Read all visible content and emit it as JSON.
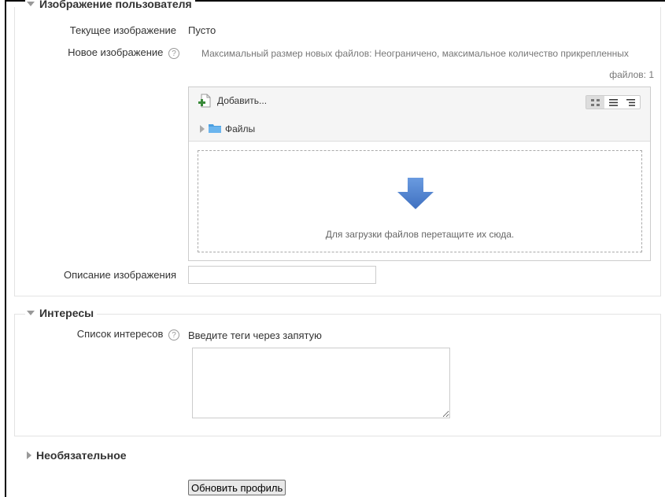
{
  "section_image": {
    "legend": "Изображение пользователя",
    "current_label": "Текущее изображение",
    "current_value": "Пусто",
    "new_label": "Новое изображение",
    "limit_text_line1": "Максимальный размер новых файлов: Неограничено, максимальное количество прикрепленных",
    "limit_text_line2": "файлов: 1",
    "add_label": "Добавить...",
    "folder_label": "Файлы",
    "drop_hint": "Для загрузки файлов перетащите их сюда.",
    "description_label": "Описание изображения",
    "description_value": ""
  },
  "section_interests": {
    "legend": "Интересы",
    "list_label": "Список интересов",
    "hint": "Введите теги через запятую",
    "value": ""
  },
  "section_optional": {
    "legend": "Необязательное"
  },
  "submit_label": "Обновить профиль",
  "help_glyph": "?",
  "colors": {
    "drop_arrow": "#5b8dd9",
    "folder": "#4a9fe0"
  }
}
